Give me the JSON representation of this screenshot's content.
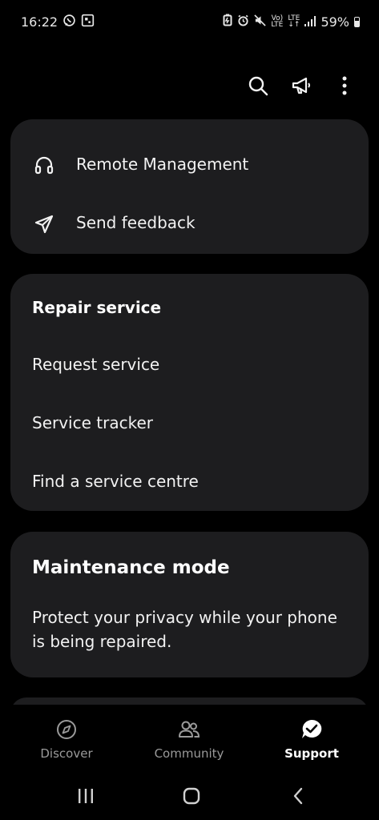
{
  "status_bar": {
    "time": "16:22",
    "volte": "Vo)",
    "lte": "LTE",
    "lte2": "LTE",
    "battery": "59%"
  },
  "top_actions": {
    "icons": [
      "search-icon",
      "megaphone-icon",
      "more-vertical-icon"
    ]
  },
  "quick_links": [
    {
      "label": "Remote Management",
      "icon": "headset-icon"
    },
    {
      "label": "Send feedback",
      "icon": "send-icon"
    }
  ],
  "repair_service": {
    "title": "Repair service",
    "items": [
      "Request service",
      "Service tracker",
      "Find a service centre"
    ]
  },
  "maintenance": {
    "title": "Maintenance mode",
    "description": "Protect your privacy while your phone is being repaired."
  },
  "bottom_nav": {
    "items": [
      {
        "label": "Discover",
        "icon": "compass-icon",
        "active": false
      },
      {
        "label": "Community",
        "icon": "people-icon",
        "active": false
      },
      {
        "label": "Support",
        "icon": "support-chat-icon",
        "active": true
      }
    ]
  },
  "colors": {
    "background": "#000000",
    "card": "#1d1d1f",
    "text": "#f2f2f2",
    "inactive_nav": "#9a9a9a"
  }
}
